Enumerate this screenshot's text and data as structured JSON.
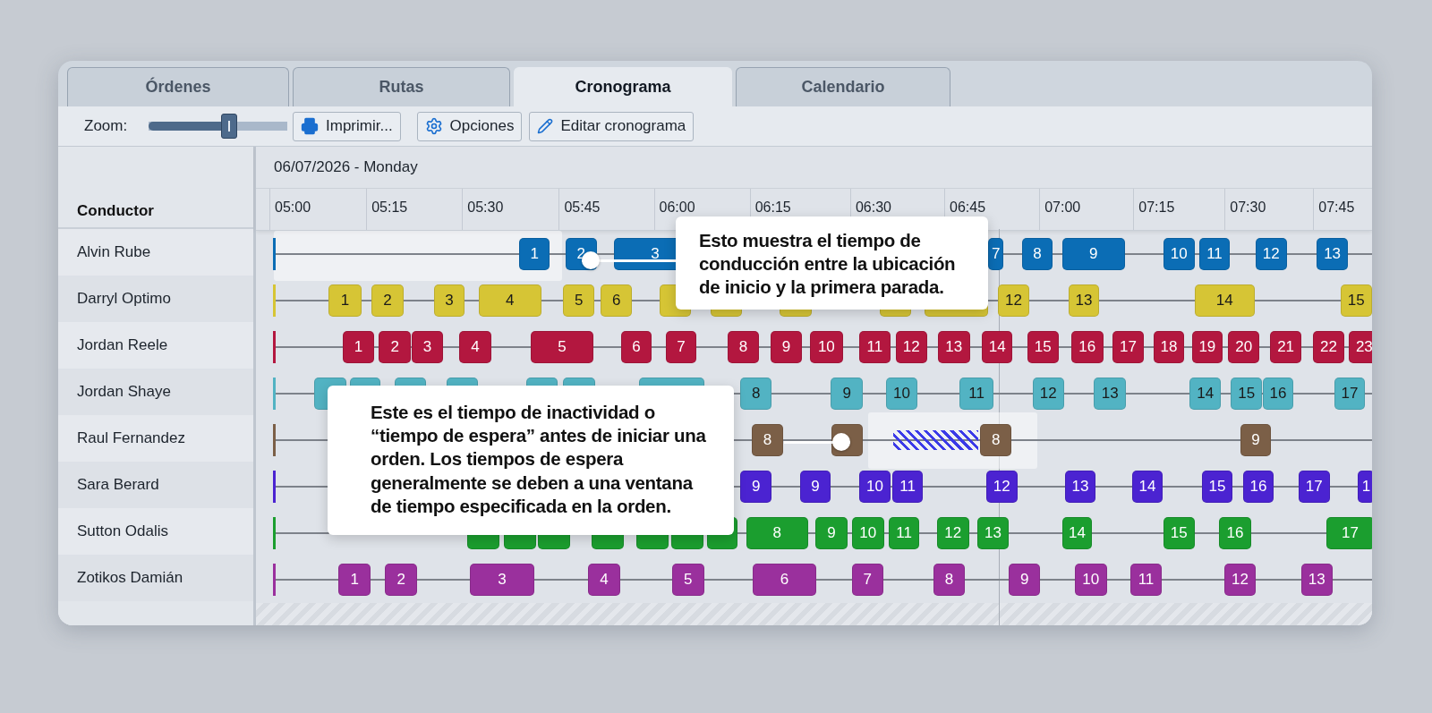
{
  "tabs": [
    {
      "label": "Órdenes",
      "selected": false
    },
    {
      "label": "Rutas",
      "selected": false
    },
    {
      "label": "Cronograma",
      "selected": true
    },
    {
      "label": "Calendario",
      "selected": false
    }
  ],
  "toolbar": {
    "zoom_label": "Zoom:",
    "zoom": {
      "level": 0.58
    },
    "buttons": [
      {
        "kind": "print",
        "label": "Imprimir..."
      },
      {
        "kind": "settings",
        "label": "Opciones"
      },
      {
        "kind": "edit",
        "label": "Editar cronograma"
      }
    ]
  },
  "schedule": {
    "date": "06/07/2026 - Monday",
    "driver_heading": "Conductor",
    "times": [
      "05:00",
      "05:15",
      "05:30",
      "05:45",
      "06:00",
      "06:15",
      "06:30",
      "06:45",
      "07:00",
      "07:15",
      "07:30",
      "07:45"
    ],
    "drivers": [
      {
        "name": "Alvin Rube",
        "color": "#0b6db5",
        "stops": [
          {
            "kind": "stop",
            "label": "1"
          },
          {
            "kind": "stop",
            "label": "2"
          },
          {
            "kind": "stop",
            "label": "3"
          },
          {
            "kind": "stop",
            "label": "7"
          },
          {
            "kind": "stop",
            "label": "8"
          },
          {
            "kind": "stop",
            "label": "9"
          },
          {
            "kind": "stop",
            "label": "10"
          },
          {
            "kind": "stop",
            "label": "11"
          },
          {
            "kind": "stop",
            "label": "12"
          },
          {
            "kind": "stop",
            "label": "13"
          }
        ]
      },
      {
        "name": "Darryl Optimo",
        "color": "#d6c535",
        "stops": [
          {
            "kind": "stop",
            "label": "1"
          },
          {
            "kind": "stop",
            "label": "2"
          },
          {
            "kind": "stop",
            "label": "3"
          },
          {
            "kind": "stop",
            "label": "4"
          },
          {
            "kind": "stop",
            "label": "5"
          },
          {
            "kind": "stop",
            "label": "6"
          },
          {
            "kind": "covered"
          },
          {
            "kind": "covered"
          },
          {
            "kind": "covered"
          },
          {
            "kind": "covered"
          },
          {
            "kind": "covered"
          },
          {
            "kind": "stop",
            "label": "12"
          },
          {
            "kind": "stop",
            "label": "13"
          },
          {
            "kind": "stop",
            "label": "14"
          },
          {
            "kind": "stop",
            "label": "15"
          }
        ]
      },
      {
        "name": "Jordan Reele",
        "color": "#b3173f",
        "stops": [
          {
            "kind": "stop",
            "label": "1"
          },
          {
            "kind": "stop",
            "label": "2"
          },
          {
            "kind": "stop",
            "label": "3"
          },
          {
            "kind": "stop",
            "label": "4"
          },
          {
            "kind": "stop",
            "label": "5"
          },
          {
            "kind": "stop",
            "label": "6"
          },
          {
            "kind": "stop",
            "label": "7"
          },
          {
            "kind": "stop",
            "label": "8"
          },
          {
            "kind": "stop",
            "label": "9"
          },
          {
            "kind": "stop",
            "label": "10"
          },
          {
            "kind": "stop",
            "label": "11"
          },
          {
            "kind": "stop",
            "label": "12"
          },
          {
            "kind": "stop",
            "label": "13"
          },
          {
            "kind": "stop",
            "label": "14"
          },
          {
            "kind": "stop",
            "label": "15"
          },
          {
            "kind": "stop",
            "label": "16"
          },
          {
            "kind": "stop",
            "label": "17"
          },
          {
            "kind": "stop",
            "label": "18"
          },
          {
            "kind": "stop",
            "label": "19"
          },
          {
            "kind": "stop",
            "label": "20"
          },
          {
            "kind": "stop",
            "label": "21"
          },
          {
            "kind": "stop",
            "label": "22"
          },
          {
            "kind": "stop",
            "label": "23"
          }
        ]
      },
      {
        "name": "Jordan Shaye",
        "color": "#52b3c3",
        "stops": [
          {
            "kind": "covered"
          },
          {
            "kind": "covered"
          },
          {
            "kind": "covered"
          },
          {
            "kind": "covered"
          },
          {
            "kind": "covered"
          },
          {
            "kind": "covered"
          },
          {
            "kind": "covered"
          },
          {
            "kind": "stop",
            "label": "8"
          },
          {
            "kind": "stop",
            "label": "9"
          },
          {
            "kind": "stop",
            "label": "10"
          },
          {
            "kind": "stop",
            "label": "11"
          },
          {
            "kind": "stop",
            "label": "12"
          },
          {
            "kind": "stop",
            "label": "13"
          },
          {
            "kind": "stop",
            "label": "14"
          },
          {
            "kind": "stop",
            "label": "15"
          },
          {
            "kind": "stop",
            "label": "16"
          },
          {
            "kind": "stop",
            "label": "17"
          }
        ]
      },
      {
        "name": "Raul Fernandez",
        "color": "#7b5f47",
        "stops": [
          {
            "kind": "stop",
            "label": "8"
          },
          {
            "kind": "covered"
          },
          {
            "kind": "wait"
          },
          {
            "kind": "stop",
            "label": "8"
          },
          {
            "kind": "stop",
            "label": "9"
          }
        ]
      },
      {
        "name": "Sara Berard",
        "color": "#4b23d1",
        "stops": [
          {
            "kind": "stop",
            "label": "9"
          },
          {
            "kind": "stop",
            "label": "9"
          },
          {
            "kind": "stop",
            "label": "10"
          },
          {
            "kind": "stop",
            "label": "11"
          },
          {
            "kind": "stop",
            "label": "12"
          },
          {
            "kind": "stop",
            "label": "13"
          },
          {
            "kind": "stop",
            "label": "14"
          },
          {
            "kind": "stop",
            "label": "15"
          },
          {
            "kind": "stop",
            "label": "16"
          },
          {
            "kind": "stop",
            "label": "17"
          },
          {
            "kind": "stop",
            "label": "1"
          }
        ]
      },
      {
        "name": "Sutton Odalis",
        "color": "#1b9e2f",
        "stops": [
          {
            "kind": "covered"
          },
          {
            "kind": "covered"
          },
          {
            "kind": "covered"
          },
          {
            "kind": "covered"
          },
          {
            "kind": "covered"
          },
          {
            "kind": "covered"
          },
          {
            "kind": "covered"
          },
          {
            "kind": "stop",
            "label": "8"
          },
          {
            "kind": "stop",
            "label": "9"
          },
          {
            "kind": "stop",
            "label": "10"
          },
          {
            "kind": "stop",
            "label": "11"
          },
          {
            "kind": "stop",
            "label": "12"
          },
          {
            "kind": "stop",
            "label": "13"
          },
          {
            "kind": "stop",
            "label": "14"
          },
          {
            "kind": "stop",
            "label": "15"
          },
          {
            "kind": "stop",
            "label": "16"
          },
          {
            "kind": "stop",
            "label": "17"
          }
        ]
      },
      {
        "name": "Zotikos Damián",
        "color": "#9a309d",
        "stops": [
          {
            "kind": "stop",
            "label": "1"
          },
          {
            "kind": "stop",
            "label": "2"
          },
          {
            "kind": "stop",
            "label": "3"
          },
          {
            "kind": "stop",
            "label": "4"
          },
          {
            "kind": "stop",
            "label": "5"
          },
          {
            "kind": "stop",
            "label": "6"
          },
          {
            "kind": "stop",
            "label": "7"
          },
          {
            "kind": "stop",
            "label": "8"
          },
          {
            "kind": "stop",
            "label": "9"
          },
          {
            "kind": "stop",
            "label": "10"
          },
          {
            "kind": "stop",
            "label": "11"
          },
          {
            "kind": "stop",
            "label": "12"
          },
          {
            "kind": "stop",
            "label": "13"
          }
        ]
      }
    ]
  },
  "callouts": [
    {
      "text": "Esto muestra el tiempo de conducción entre la ubicación de inicio y la primera parada."
    },
    {
      "text": "Este es el tiempo de inactividad o “tiempo de espera” antes de iniciar una orden. Los tiempos de espera generalmente se deben a una ventana de tiempo especificada en la orden."
    }
  ]
}
